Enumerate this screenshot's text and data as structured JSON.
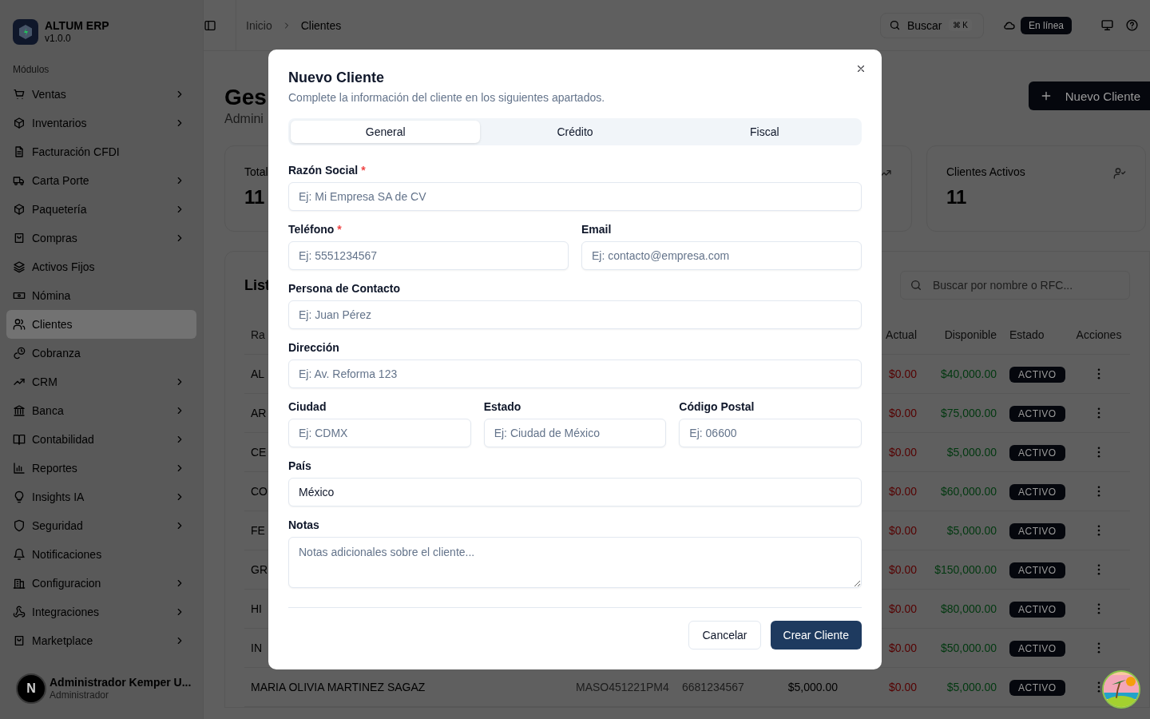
{
  "sidebar": {
    "brand": "ALTUM ERP",
    "version": "v1.0.0",
    "section": "Módulos",
    "items": [
      {
        "label": "Ventas",
        "submenu": true,
        "selected": false
      },
      {
        "label": "Inventarios",
        "submenu": true,
        "selected": false
      },
      {
        "label": "Facturación CFDI",
        "submenu": false,
        "selected": false
      },
      {
        "label": "Carta Porte",
        "submenu": true,
        "selected": false
      },
      {
        "label": "Paquetería",
        "submenu": true,
        "selected": false
      },
      {
        "label": "Compras",
        "submenu": true,
        "selected": false
      },
      {
        "label": "Activos Fijos",
        "submenu": false,
        "selected": false
      },
      {
        "label": "Nómina",
        "submenu": false,
        "selected": false
      },
      {
        "label": "Clientes",
        "submenu": false,
        "selected": true
      },
      {
        "label": "Cobranza",
        "submenu": false,
        "selected": false
      },
      {
        "label": "CRM",
        "submenu": true,
        "selected": false
      },
      {
        "label": "Banca",
        "submenu": true,
        "selected": false
      },
      {
        "label": "Contabilidad",
        "submenu": true,
        "selected": false
      },
      {
        "label": "Reportes",
        "submenu": true,
        "selected": false
      },
      {
        "label": "Insights IA",
        "submenu": true,
        "selected": false
      },
      {
        "label": "Seguridad",
        "submenu": true,
        "selected": false
      },
      {
        "label": "Notificaciones",
        "submenu": false,
        "selected": false
      },
      {
        "label": "Configuracion",
        "submenu": true,
        "selected": false
      },
      {
        "label": "Integraciones",
        "submenu": true,
        "selected": false
      },
      {
        "label": "Marketplace",
        "submenu": true,
        "selected": false
      }
    ],
    "user": {
      "initial": "N",
      "name": "Administrador Kemper U...",
      "role": "Administrador"
    }
  },
  "header": {
    "breadcrumb": [
      "Inicio",
      "Clientes"
    ],
    "search": {
      "label": "Buscar",
      "shortcut": "⌘ K"
    },
    "status": "En línea"
  },
  "page": {
    "title": "Ges",
    "subtitle": "Admini",
    "new_button": "Nuevo Cliente",
    "stats": [
      {
        "label": "Total",
        "value": "11"
      },
      {
        "label": "Clientes Activos",
        "value": "11"
      }
    ],
    "table": {
      "title": "List",
      "search_placeholder": "Buscar por nombre o RFC...",
      "columns": {
        "name": "Ra",
        "actual": "Actual",
        "available": "Disponible",
        "status": "Estado",
        "actions": "Acciones"
      },
      "rows": [
        {
          "name": "AL",
          "actual": "$0.00",
          "available": "$40,000.00",
          "status": "ACTIVO"
        },
        {
          "name": "AR",
          "actual": "$0.00",
          "available": "$75,000.00",
          "status": "ACTIVO"
        },
        {
          "name": "CE",
          "actual": "$0.00",
          "available": "$5,000.00",
          "status": "ACTIVO"
        },
        {
          "name": "CO",
          "actual": "$0.00",
          "available": "$60,000.00",
          "status": "ACTIVO"
        },
        {
          "name": "FE",
          "actual": "$0.00",
          "available": "$5,000.00",
          "status": "ACTIVO"
        },
        {
          "name": "GR",
          "actual": "$0.00",
          "available": "$150,000.00",
          "status": "ACTIVO"
        },
        {
          "name": "HI",
          "actual": "$0.00",
          "available": "$80,000.00",
          "status": "ACTIVO"
        },
        {
          "name": "IN",
          "actual": "$0.00",
          "available": "$50,000.00",
          "status": "ACTIVO"
        },
        {
          "name": "MARIA OLIVIA MARTINEZ SAGAZ",
          "rfc": "MASO451221PM4",
          "phone": "6681234567",
          "limit": "$5,000.00",
          "actual": "$0.00",
          "available": "$5,000.00",
          "status": "ACTIVO"
        }
      ]
    }
  },
  "modal": {
    "title": "Nuevo Cliente",
    "description": "Complete la información del cliente en los siguientes apartados.",
    "tabs": [
      {
        "label": "General",
        "selected": true
      },
      {
        "label": "Crédito",
        "selected": false
      },
      {
        "label": "Fiscal",
        "selected": false
      }
    ],
    "rows": [
      [
        {
          "label": "Razón Social",
          "required_mark": "*",
          "kind": "input",
          "placeholder": "Ej: Mi Empresa SA de CV"
        }
      ],
      [
        {
          "label": "Teléfono",
          "required_mark": "*",
          "kind": "input",
          "placeholder": "Ej: 5551234567"
        },
        {
          "label": "Email",
          "kind": "input",
          "placeholder": "Ej: contacto@empresa.com"
        }
      ],
      [
        {
          "label": "Persona de Contacto",
          "kind": "input",
          "placeholder": "Ej: Juan Pérez"
        }
      ],
      [
        {
          "label": "Dirección",
          "kind": "input",
          "placeholder": "Ej: Av. Reforma 123"
        }
      ],
      [
        {
          "label": "Ciudad",
          "kind": "input",
          "placeholder": "Ej: CDMX"
        },
        {
          "label": "Estado",
          "kind": "input",
          "placeholder": "Ej: Ciudad de México"
        },
        {
          "label": "Código Postal",
          "kind": "input",
          "placeholder": "Ej: 06600"
        }
      ],
      [
        {
          "label": "País",
          "kind": "input",
          "value": "México"
        }
      ],
      [
        {
          "label": "Notas",
          "kind": "textarea",
          "placeholder": "Notas adicionales sobre el cliente..."
        }
      ]
    ],
    "buttons": {
      "cancel": "Cancelar",
      "submit": "Crear Cliente"
    }
  }
}
